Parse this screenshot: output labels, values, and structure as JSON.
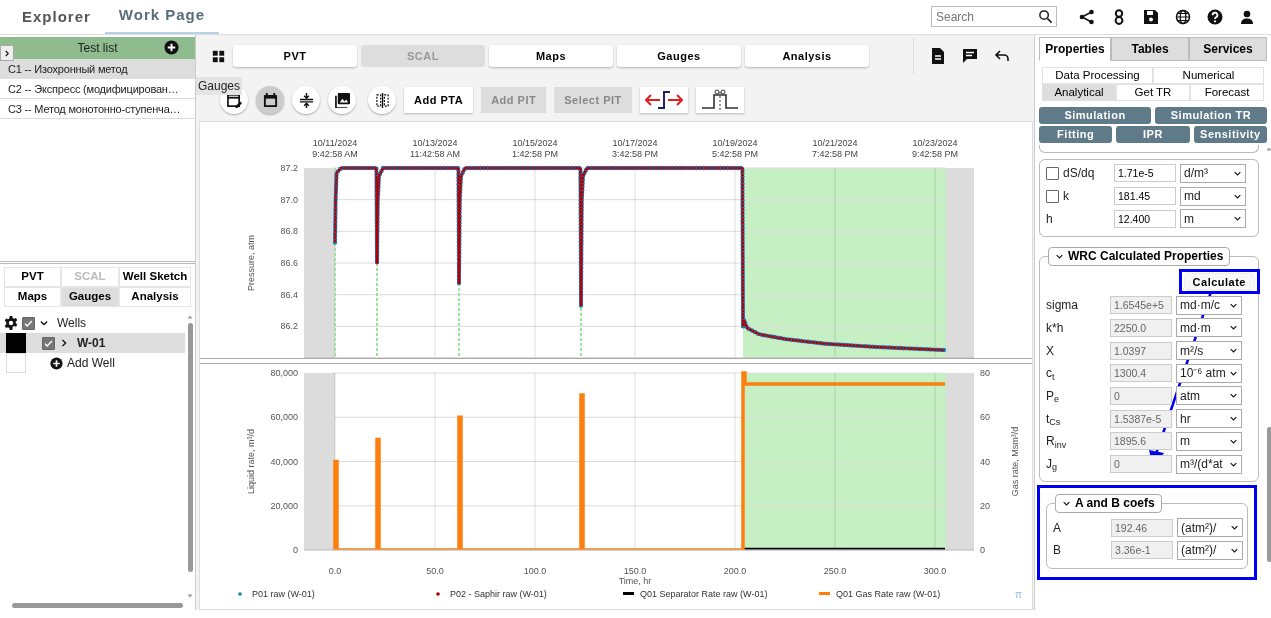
{
  "top_tabs": [
    {
      "label": "Explorer",
      "selected": false
    },
    {
      "label": "Work Page",
      "selected": true
    }
  ],
  "search": {
    "placeholder": "Search"
  },
  "test_list": {
    "title": "Test list",
    "items": [
      {
        "label": "C1 -- Изохронный метод",
        "selected": true
      },
      {
        "label": "C2 -- Экспресс (модифицирован…",
        "selected": false
      },
      {
        "label": "C3 -- Метод монотонно-ступенча…",
        "selected": false
      }
    ]
  },
  "left_tabs": [
    {
      "label": "PVT",
      "selected": false,
      "disabled": false
    },
    {
      "label": "SCAL",
      "selected": false,
      "disabled": true
    },
    {
      "label": "Well Sketch",
      "selected": false,
      "disabled": false
    },
    {
      "label": "Maps",
      "selected": false,
      "disabled": false
    },
    {
      "label": "Gauges",
      "selected": true,
      "disabled": false
    },
    {
      "label": "Analysis",
      "selected": false,
      "disabled": false
    }
  ],
  "tree": [
    {
      "label": "Wells",
      "checked": true,
      "expanded": true,
      "children": [
        {
          "label": "W-01",
          "checked": true,
          "expanded": false,
          "selected": true,
          "color": "#000000"
        }
      ]
    }
  ],
  "add_well": "Add Well",
  "main_tabs": [
    {
      "label": "PVT",
      "disabled": false
    },
    {
      "label": "SCAL",
      "disabled": true
    },
    {
      "label": "Maps",
      "disabled": false
    },
    {
      "label": "Gauges",
      "disabled": false
    },
    {
      "label": "Analysis",
      "disabled": false
    }
  ],
  "tooltip": "Gauges",
  "round_tools": [
    {
      "selected": false
    },
    {
      "selected": true
    },
    {
      "selected": false
    },
    {
      "selected": false
    },
    {
      "selected": false
    }
  ],
  "tool_buttons": [
    {
      "label": "Add PTA",
      "disabled": false
    },
    {
      "label": "Add PIT",
      "disabled": true
    },
    {
      "label": "Select PIT",
      "disabled": true
    }
  ],
  "pressure_chart": {
    "chart_data": {
      "type": "line",
      "grid": true,
      "ylabel": "Pressure, atm",
      "x": [
        0,
        0.3,
        0.8,
        3,
        20.7,
        21,
        21.4,
        22,
        24,
        61.7,
        62,
        62.4,
        63,
        65,
        122.7,
        123,
        123.4,
        124,
        126,
        203.7,
        204,
        204.5,
        206,
        212,
        225,
        245,
        270,
        305
      ],
      "series": [
        {
          "name": "P01 raw (W-01)",
          "color": "#1f77b4",
          "line_style": "dotted",
          "values": [
            86.73,
            87.0,
            87.17,
            87.2,
            87.2,
            86.6,
            87.0,
            87.15,
            87.2,
            87.2,
            86.47,
            87.0,
            87.15,
            87.2,
            87.2,
            86.33,
            87.0,
            87.15,
            87.2,
            87.2,
            86.2,
            86.24,
            86.19,
            86.15,
            86.12,
            86.09,
            86.07,
            86.05
          ]
        },
        {
          "name": "P02 - Saphir raw (W-01)",
          "color": "#b00000",
          "line_style": "dotted",
          "values": [
            86.73,
            87.0,
            87.17,
            87.2,
            87.2,
            86.6,
            87.0,
            87.15,
            87.2,
            87.2,
            86.47,
            87.0,
            87.15,
            87.2,
            87.2,
            86.33,
            87.0,
            87.15,
            87.2,
            87.2,
            86.2,
            86.24,
            86.19,
            86.15,
            86.12,
            86.09,
            86.07,
            86.05
          ]
        }
      ],
      "xlim": [
        -15.5,
        319.5
      ],
      "ylim": [
        86.0,
        87.2
      ],
      "yticks": [
        {
          "value": 87.2,
          "label": "87.2"
        },
        {
          "value": 87.0,
          "label": "87.0"
        },
        {
          "value": 86.8,
          "label": "86.8"
        },
        {
          "value": 86.6,
          "label": "86.6"
        },
        {
          "value": 86.4,
          "label": "86.4"
        },
        {
          "value": 86.2,
          "label": "86.2"
        }
      ],
      "bands": [
        {
          "axis": "x",
          "from": -15.5,
          "to": 0,
          "color": "#dcdcdc"
        },
        {
          "axis": "x",
          "from": 305.5,
          "to": 319.5,
          "color": "#dcdcdc"
        },
        {
          "axis": "x",
          "from": 204,
          "to": 305.5,
          "color": "#c6f0c4"
        }
      ],
      "ref_lines": [
        {
          "axis": "x",
          "value": 0,
          "color": "#9de29b"
        },
        {
          "axis": "x",
          "value": 21,
          "color": "#9de29b"
        },
        {
          "axis": "x",
          "value": 62,
          "color": "#9de29b"
        },
        {
          "axis": "x",
          "value": 123,
          "color": "#9de29b"
        }
      ]
    },
    "date_labels": [
      "10/11/2024 9:42:58 AM",
      "10/13/2024 11:42:58 AM",
      "10/15/2024 1:42:58 PM",
      "10/17/2024 3:42:58 PM",
      "10/19/2024 5:42:58 PM",
      "10/21/2024 7:42:58 PM",
      "10/23/2024 9:42:58 PM"
    ]
  },
  "rate_chart": {
    "chart_data": {
      "type": "line",
      "grid": true,
      "legend": "bottom",
      "xlabel": "Time, hr",
      "ylabel": "Liquid rate, m³/d",
      "y2label": "Gas rate, Msm³/d",
      "x": [
        0,
        0,
        1,
        1,
        21,
        21,
        22,
        22,
        62,
        62,
        63,
        63,
        123,
        123,
        124,
        124,
        204,
        204,
        205,
        205,
        305
      ],
      "series": [
        {
          "name": "Q01 Separator Rate raw (W-01)",
          "color": "#000000",
          "values": [
            null,
            null,
            null,
            null,
            null,
            null,
            null,
            null,
            null,
            null,
            null,
            null,
            null,
            null,
            null,
            null,
            null,
            600,
            600,
            600,
            600
          ]
        },
        {
          "name": "Q01 Gas Rate raw (W-01)",
          "color": "#ff7f0e",
          "axis": "y2",
          "values": [
            0,
            40,
            40,
            0,
            0,
            50,
            50,
            0,
            0,
            60,
            60,
            0,
            0,
            70,
            70,
            0,
            0,
            80,
            80,
            75,
            75
          ]
        }
      ],
      "xlim": [
        -15.5,
        319.5
      ],
      "ylim": [
        0,
        80000
      ],
      "y2lim": [
        0,
        80
      ],
      "xticks": [
        {
          "value": 0,
          "label": "0.0"
        },
        {
          "value": 50,
          "label": "50.0"
        },
        {
          "value": 100,
          "label": "100.0"
        },
        {
          "value": 150,
          "label": "150.0"
        },
        {
          "value": 200,
          "label": "200.0"
        },
        {
          "value": 250,
          "label": "250.0"
        },
        {
          "value": 300,
          "label": "300.0"
        }
      ],
      "yticks": [
        {
          "value": 80000,
          "label": "80,000"
        },
        {
          "value": 60000,
          "label": "60,000"
        },
        {
          "value": 40000,
          "label": "40,000"
        },
        {
          "value": 20000,
          "label": "20,000"
        },
        {
          "value": 0,
          "label": "0"
        }
      ],
      "y2ticks": [
        {
          "value": 80,
          "label": "80"
        },
        {
          "value": 60,
          "label": "60"
        },
        {
          "value": 40,
          "label": "40"
        },
        {
          "value": 20,
          "label": "20"
        },
        {
          "value": 0,
          "label": "0"
        }
      ],
      "bands": [
        {
          "axis": "x",
          "from": -15.5,
          "to": 0,
          "color": "#dcdcdc"
        },
        {
          "axis": "x",
          "from": 305.5,
          "to": 319.5,
          "color": "#dcdcdc"
        },
        {
          "axis": "x",
          "from": 204,
          "to": 305.5,
          "color": "#c6f0c4"
        }
      ]
    }
  },
  "pi_mark": "π",
  "right_tabs": [
    {
      "label": "Properties",
      "selected": true
    },
    {
      "label": "Tables",
      "selected": false
    },
    {
      "label": "Services",
      "selected": false
    }
  ],
  "sub_tabs": [
    {
      "label": "Data Processing",
      "selected": false
    },
    {
      "label": "Numerical",
      "selected": false
    },
    {
      "label": "Analytical",
      "selected": true
    },
    {
      "label": "Get TR",
      "selected": false
    },
    {
      "label": "Forecast",
      "selected": false
    }
  ],
  "action_buttons": [
    "Simulation",
    "Simulation TR",
    "Fitting",
    "IPR",
    "Sensitivity"
  ],
  "params": [
    {
      "kind": "check",
      "label": "dS/dq",
      "checked": false,
      "value": "1.71e-5",
      "unit": "d/m³"
    },
    {
      "kind": "check",
      "label": "k",
      "checked": false,
      "value": "181.45",
      "unit": "md"
    },
    {
      "kind": "plain",
      "label": "h",
      "value": "12.400",
      "unit": "m"
    }
  ],
  "wrc": {
    "title": "WRC Calculated Properties",
    "expanded": true,
    "calculate": "Calculate",
    "rows": [
      {
        "label": "sigma",
        "value": "1.6545e+5",
        "unit": "md·m/c",
        "disabled": true
      },
      {
        "label": "k*h",
        "value": "2250.0",
        "unit": "md·m",
        "disabled": true
      },
      {
        "label": "X",
        "value": "1.0397",
        "unit": "m²/s",
        "disabled": true
      },
      {
        "label": "c$_{t}$",
        "value": "1300.4",
        "unit": "10⁻⁶ atm",
        "disabled": true
      },
      {
        "label": "P$_{e}$",
        "value": "0",
        "unit": "atm",
        "disabled": true
      },
      {
        "label": "t$_{Cs}$",
        "value": "1.5387e-5",
        "unit": "hr",
        "disabled": true
      },
      {
        "label": "R$_{inv}$",
        "value": "1895.6",
        "unit": "m",
        "disabled": true
      },
      {
        "label": "J$_{g}$",
        "value": "0",
        "unit": "m³/(d*at",
        "disabled": true
      }
    ]
  },
  "coefs": {
    "title": "A and B coefs",
    "expanded": true,
    "rows": [
      {
        "label": "A",
        "value": "192.46",
        "unit": "(atm²)/",
        "disabled": true
      },
      {
        "label": "B",
        "value": "3.36e-1",
        "unit": "(atm²)/",
        "disabled": true
      }
    ]
  }
}
